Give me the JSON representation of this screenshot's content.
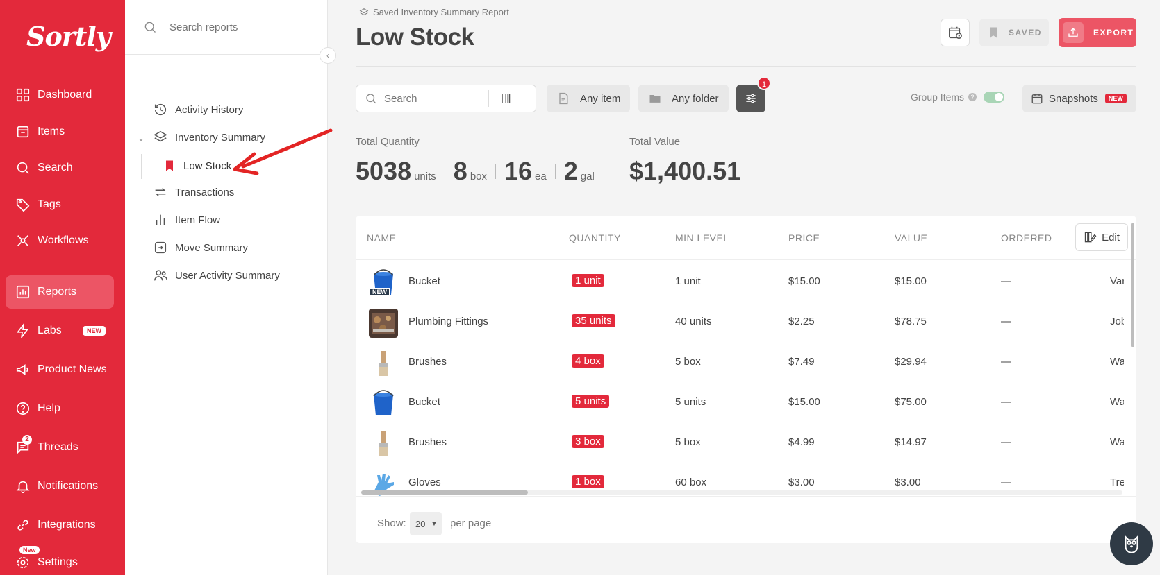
{
  "app": {
    "logo": "Sortly"
  },
  "nav": {
    "items": [
      {
        "label": "Dashboard",
        "icon": "dashboard-icon"
      },
      {
        "label": "Items",
        "icon": "items-icon"
      },
      {
        "label": "Search",
        "icon": "search-icon"
      },
      {
        "label": "Tags",
        "icon": "tag-icon"
      },
      {
        "label": "Workflows",
        "icon": "workflows-icon"
      },
      {
        "label": "Reports",
        "icon": "reports-icon",
        "active": true
      },
      {
        "label": "Labs",
        "icon": "lightning-icon",
        "badge": "NEW"
      },
      {
        "label": "Product News",
        "icon": "megaphone-icon"
      },
      {
        "label": "Help",
        "icon": "help-icon"
      },
      {
        "label": "Threads",
        "icon": "threads-icon",
        "count": "2"
      },
      {
        "label": "Notifications",
        "icon": "bell-icon"
      },
      {
        "label": "Integrations",
        "icon": "integrations-icon"
      },
      {
        "label": "Settings",
        "icon": "gear-icon",
        "badge_top": "New"
      }
    ]
  },
  "reports_panel": {
    "search_placeholder": "Search reports",
    "items": [
      {
        "label": "Activity History",
        "icon": "history-icon"
      },
      {
        "label": "Inventory Summary",
        "icon": "layers-icon",
        "expanded": true
      },
      {
        "label": "Transactions",
        "icon": "transactions-icon"
      },
      {
        "label": "Item Flow",
        "icon": "bar-chart-icon"
      },
      {
        "label": "Move Summary",
        "icon": "move-icon"
      },
      {
        "label": "User Activity Summary",
        "icon": "users-icon"
      }
    ],
    "child": {
      "label": "Low Stock",
      "icon": "bookmark-icon"
    }
  },
  "header": {
    "breadcrumb": "Saved Inventory Summary Report",
    "title": "Low Stock",
    "saved_label": "SAVED",
    "export_label": "EXPORT"
  },
  "filters": {
    "search_placeholder": "Search",
    "any_item": "Any item",
    "any_folder": "Any folder",
    "filter_count": "1",
    "group_items_label": "Group Items",
    "group_items_on": true,
    "snapshots_label": "Snapshots",
    "snapshots_badge": "NEW"
  },
  "totals": {
    "quantity_label": "Total Quantity",
    "value_label": "Total Value",
    "quantities": [
      {
        "value": "5038",
        "unit": "units"
      },
      {
        "value": "8",
        "unit": "box"
      },
      {
        "value": "16",
        "unit": "ea"
      },
      {
        "value": "2",
        "unit": "gal"
      }
    ],
    "value": "$1,400.51"
  },
  "table": {
    "columns": [
      "NAME",
      "QUANTITY",
      "MIN LEVEL",
      "PRICE",
      "VALUE",
      "ORDERED"
    ],
    "edit_label": "Edit",
    "rows": [
      {
        "thumb": "bucket",
        "new": "NEW",
        "name": "Bucket",
        "quantity": "1 unit",
        "min_level": "1 unit",
        "price": "$15.00",
        "value": "$15.00",
        "ordered": "—",
        "extra": "Van"
      },
      {
        "thumb": "fittings",
        "name": "Plumbing Fittings",
        "quantity": "35 units",
        "min_level": "40 units",
        "price": "$2.25",
        "value": "$78.75",
        "ordered": "—",
        "extra": "Job"
      },
      {
        "thumb": "brush",
        "name": "Brushes",
        "quantity": "4 box",
        "min_level": "5 box",
        "price": "$7.49",
        "value": "$29.94",
        "ordered": "—",
        "extra": "War"
      },
      {
        "thumb": "bucket",
        "name": "Bucket",
        "quantity": "5 units",
        "min_level": "5 units",
        "price": "$15.00",
        "value": "$75.00",
        "ordered": "—",
        "extra": "War"
      },
      {
        "thumb": "brush",
        "name": "Brushes",
        "quantity": "3 box",
        "min_level": "5 box",
        "price": "$4.99",
        "value": "$14.97",
        "ordered": "—",
        "extra": "War"
      },
      {
        "thumb": "gloves",
        "name": "Gloves",
        "quantity": "1 box",
        "min_level": "60 box",
        "price": "$3.00",
        "value": "$3.00",
        "ordered": "—",
        "extra": "Trey"
      }
    ],
    "show_label": "Show:",
    "per_page_value": "20",
    "per_page_label": "per page"
  },
  "colors": {
    "brand": "#e3293b",
    "nav_active": "#ec5565",
    "qty_badge": "#e3293b"
  }
}
